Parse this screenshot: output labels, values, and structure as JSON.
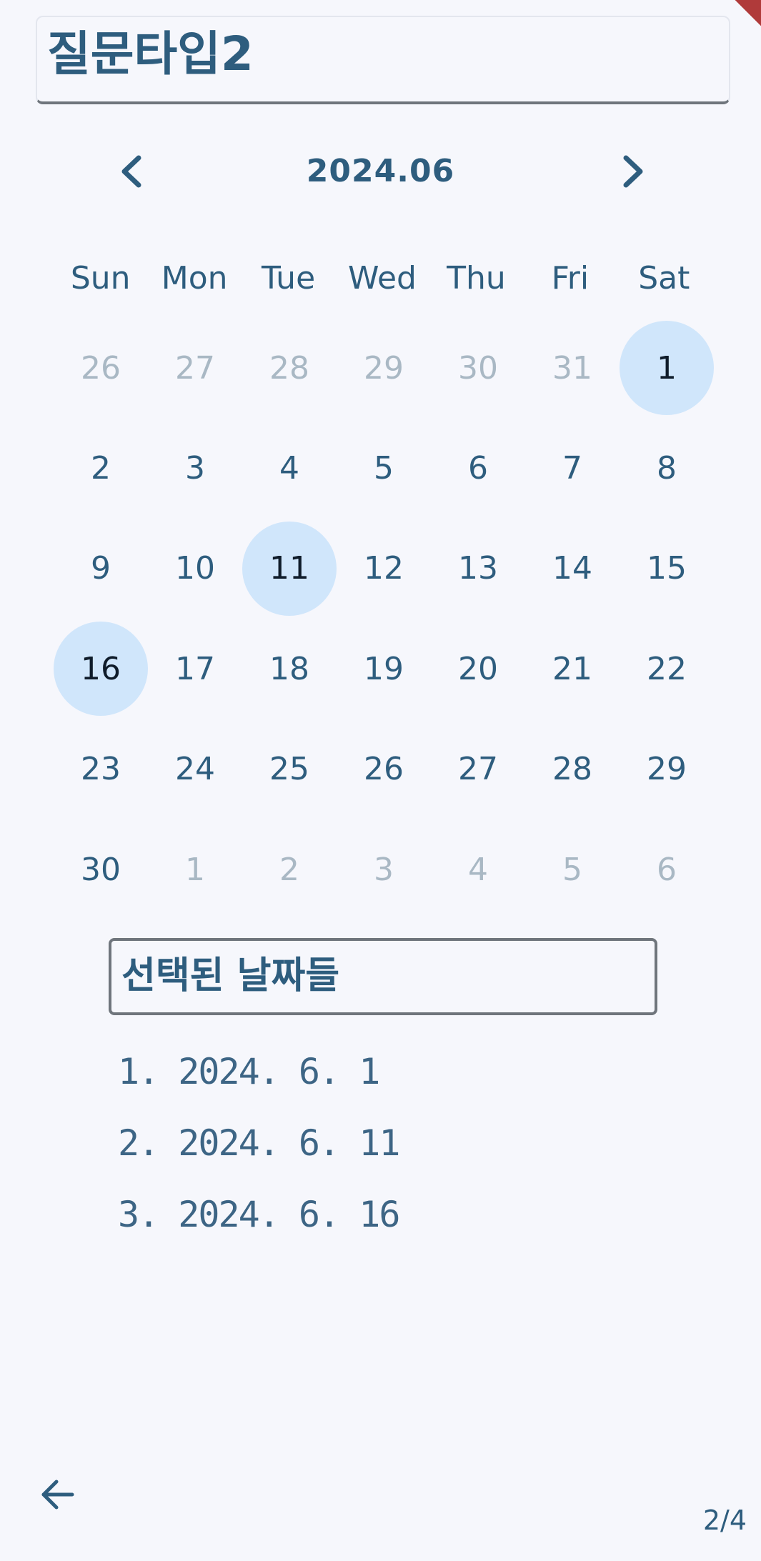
{
  "header": {
    "title": "질문타입2"
  },
  "calendar": {
    "month_label": "2024.06",
    "prev_icon": "chevron-left-icon",
    "next_icon": "chevron-right-icon",
    "weekdays": [
      "Sun",
      "Mon",
      "Tue",
      "Wed",
      "Thu",
      "Fri",
      "Sat"
    ],
    "days": [
      {
        "label": "26",
        "outside": true,
        "selected": false
      },
      {
        "label": "27",
        "outside": true,
        "selected": false
      },
      {
        "label": "28",
        "outside": true,
        "selected": false
      },
      {
        "label": "29",
        "outside": true,
        "selected": false
      },
      {
        "label": "30",
        "outside": true,
        "selected": false
      },
      {
        "label": "31",
        "outside": true,
        "selected": false
      },
      {
        "label": "1",
        "outside": false,
        "selected": true
      },
      {
        "label": "2",
        "outside": false,
        "selected": false
      },
      {
        "label": "3",
        "outside": false,
        "selected": false
      },
      {
        "label": "4",
        "outside": false,
        "selected": false
      },
      {
        "label": "5",
        "outside": false,
        "selected": false
      },
      {
        "label": "6",
        "outside": false,
        "selected": false
      },
      {
        "label": "7",
        "outside": false,
        "selected": false
      },
      {
        "label": "8",
        "outside": false,
        "selected": false
      },
      {
        "label": "9",
        "outside": false,
        "selected": false
      },
      {
        "label": "10",
        "outside": false,
        "selected": false
      },
      {
        "label": "11",
        "outside": false,
        "selected": true
      },
      {
        "label": "12",
        "outside": false,
        "selected": false
      },
      {
        "label": "13",
        "outside": false,
        "selected": false
      },
      {
        "label": "14",
        "outside": false,
        "selected": false
      },
      {
        "label": "15",
        "outside": false,
        "selected": false
      },
      {
        "label": "16",
        "outside": false,
        "selected": true
      },
      {
        "label": "17",
        "outside": false,
        "selected": false
      },
      {
        "label": "18",
        "outside": false,
        "selected": false
      },
      {
        "label": "19",
        "outside": false,
        "selected": false
      },
      {
        "label": "20",
        "outside": false,
        "selected": false
      },
      {
        "label": "21",
        "outside": false,
        "selected": false
      },
      {
        "label": "22",
        "outside": false,
        "selected": false
      },
      {
        "label": "23",
        "outside": false,
        "selected": false
      },
      {
        "label": "24",
        "outside": false,
        "selected": false
      },
      {
        "label": "25",
        "outside": false,
        "selected": false
      },
      {
        "label": "26",
        "outside": false,
        "selected": false
      },
      {
        "label": "27",
        "outside": false,
        "selected": false
      },
      {
        "label": "28",
        "outside": false,
        "selected": false
      },
      {
        "label": "29",
        "outside": false,
        "selected": false
      },
      {
        "label": "30",
        "outside": false,
        "selected": false
      },
      {
        "label": "1",
        "outside": true,
        "selected": false
      },
      {
        "label": "2",
        "outside": true,
        "selected": false
      },
      {
        "label": "3",
        "outside": true,
        "selected": false
      },
      {
        "label": "4",
        "outside": true,
        "selected": false
      },
      {
        "label": "5",
        "outside": true,
        "selected": false
      },
      {
        "label": "6",
        "outside": true,
        "selected": false
      }
    ]
  },
  "selected_section": {
    "title": "선택된 날짜들",
    "items": [
      "1. 2024. 6. 1",
      "2. 2024. 6. 11",
      "3. 2024. 6. 16"
    ]
  },
  "footer": {
    "back_icon": "arrow-left-icon",
    "page_indicator": "2/4"
  },
  "colors": {
    "background": "#f6f7fc",
    "primary_text": "#2e5d7e",
    "selected_fill": "#d0e6fb",
    "muted_text": "#a9b8c4",
    "debug_banner": "#b03a3a"
  }
}
